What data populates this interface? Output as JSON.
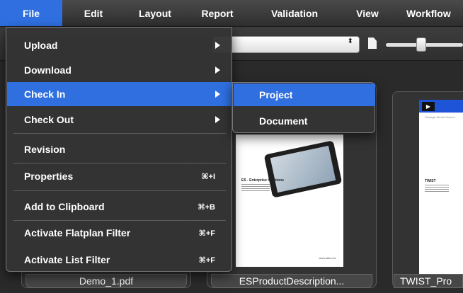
{
  "menubar": {
    "items": [
      {
        "label": "File",
        "active": true
      },
      {
        "label": "Edit"
      },
      {
        "label": "Layout"
      },
      {
        "label": "Report"
      },
      {
        "label": "Validation"
      },
      {
        "label": "View"
      },
      {
        "label": "Workflow"
      }
    ]
  },
  "file_menu": {
    "upload": "Upload",
    "download": "Download",
    "check_in": "Check In",
    "check_out": "Check Out",
    "revision": "Revision",
    "properties": "Properties",
    "properties_shortcut": "⌘+I",
    "add_to_clipboard": "Add to Clipboard",
    "add_to_clipboard_shortcut": "⌘+B",
    "activate_flatplan_filter": "Activate Flatplan Filter",
    "activate_flatplan_filter_shortcut": "⌘+F",
    "activate_list_filter": "Activate List Filter",
    "activate_list_filter_shortcut": "⌘+F"
  },
  "check_in_submenu": {
    "project": "Project",
    "document": "Document"
  },
  "toolbar": {
    "select_arrows": "⬍"
  },
  "files": [
    {
      "name": "Demo_1.pdf"
    },
    {
      "name": "ESProductDescription..."
    },
    {
      "name": "TWIST_Pro"
    }
  ],
  "thumbnails": {
    "es_title": "ES - Enterprise Solutions",
    "es_url": "www.alfa.com",
    "twist_tagline": "Strategic Media Technol",
    "twist_title": "TWIST"
  },
  "colors": {
    "accent": "#2f6fe0",
    "menu_bg": "#343434",
    "menubar_bg": "#3a3a3a"
  }
}
